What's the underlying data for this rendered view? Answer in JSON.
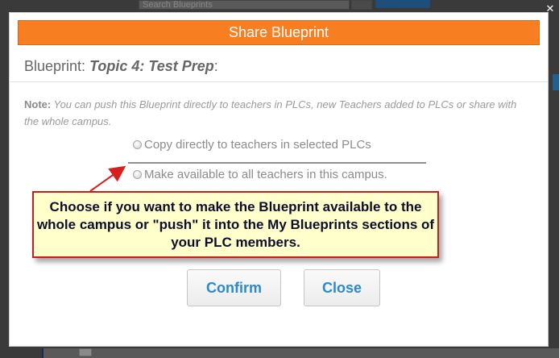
{
  "background": {
    "search_placeholder": "Search Blueprints"
  },
  "dialog": {
    "title": "Share Blueprint",
    "blueprint_label": "Blueprint:",
    "blueprint_name": "Topic 4: Test Prep",
    "blueprint_suffix": ":",
    "note_label": "Note:",
    "note_text": "You can push this Blueprint directly to teachers in PLCs, new Teachers added to PLCs or share with the whole campus.",
    "options": [
      {
        "label": "Copy directly to teachers in selected PLCs",
        "selected": false
      },
      {
        "label": "Make available to all teachers in this campus.",
        "selected": false
      }
    ],
    "close_glyph": "✕",
    "buttons": {
      "confirm": "Confirm",
      "close": "Close"
    }
  },
  "callout": {
    "text": "Choose if you want to make the Blueprint available to the whole campus or \"push\" it into the My Blueprints sections of your PLC members."
  },
  "colors": {
    "header": "#f77f22",
    "button_text": "#2a8ad0",
    "callout_border": "#c81e1e",
    "callout_bg": "#ffffcc",
    "arrow": "#d81e1e"
  }
}
